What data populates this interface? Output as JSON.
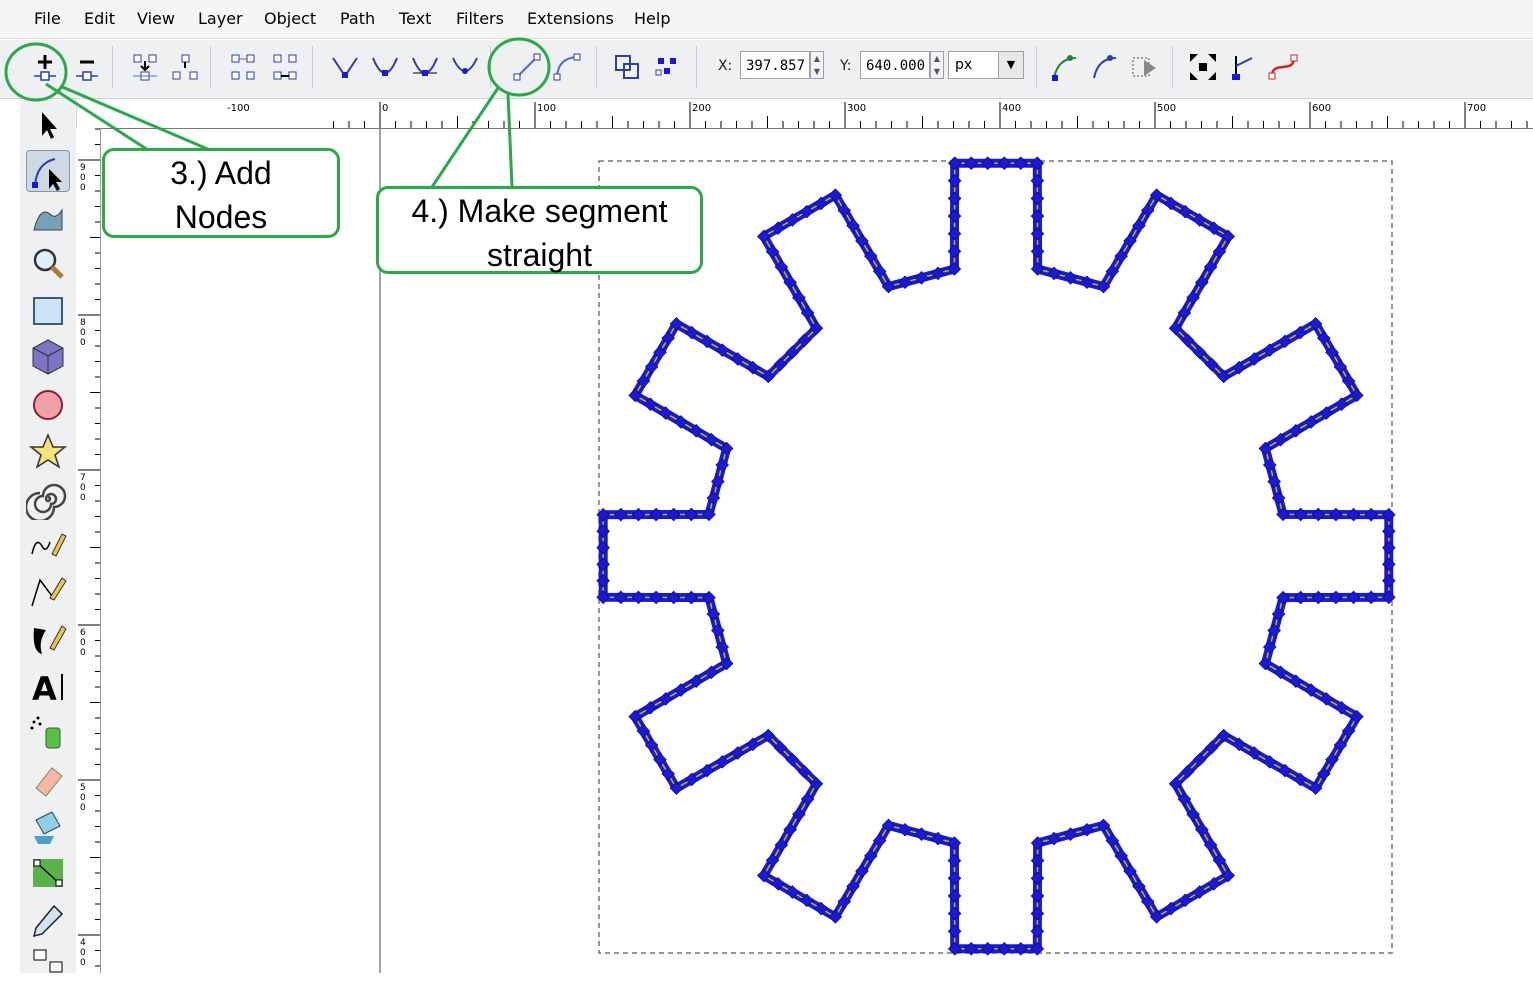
{
  "menubar": {
    "items": [
      "File",
      "Edit",
      "View",
      "Layer",
      "Object",
      "Path",
      "Text",
      "Filters",
      "Extensions",
      "Help"
    ]
  },
  "toolbar": {
    "x_label": "X:",
    "x_value": "397.857",
    "y_label": "Y:",
    "y_value": "640.000",
    "unit": "px",
    "buttons": [
      "insert-node-icon",
      "delete-node-icon",
      "join-nodes-icon",
      "break-path-icon",
      "join-segment-icon",
      "delete-segment-icon",
      "node-cusp-icon",
      "node-smooth-icon",
      "node-symmetric-icon",
      "node-auto-icon",
      "segment-to-line-icon",
      "segment-to-curve-icon",
      "object-to-path-icon",
      "stroke-to-path-icon",
      "show-handles-icon",
      "show-outline-icon",
      "edit-clip-icon",
      "transform-handles-icon",
      "edit-mask-icon",
      "path-effect-icon"
    ]
  },
  "tools": [
    "selector-icon",
    "node-tool-icon",
    "tweak-icon",
    "zoom-icon",
    "rectangle-icon",
    "box3d-icon",
    "ellipse-icon",
    "star-icon",
    "spiral-icon",
    "pencil-icon",
    "pen-icon",
    "calligraphy-icon",
    "text-icon",
    "spray-icon",
    "eraser-icon",
    "paint-bucket-icon",
    "gradient-icon",
    "dropper-icon",
    "connector-icon"
  ],
  "rulers": {
    "h_labels": [
      "-100",
      "0",
      "100",
      "200",
      "300",
      "400",
      "500",
      "600",
      "700"
    ],
    "v_labels": [
      "900",
      "800",
      "700",
      "600",
      "500",
      "400"
    ]
  },
  "callouts": {
    "add_nodes": [
      "3.) Add",
      "Nodes"
    ],
    "make_straight": [
      "4.) Make segment",
      "straight"
    ]
  },
  "colors": {
    "annotation": "#2aa84a",
    "node_fill": "#1a1ad6",
    "path_stroke": "#c8b400"
  }
}
